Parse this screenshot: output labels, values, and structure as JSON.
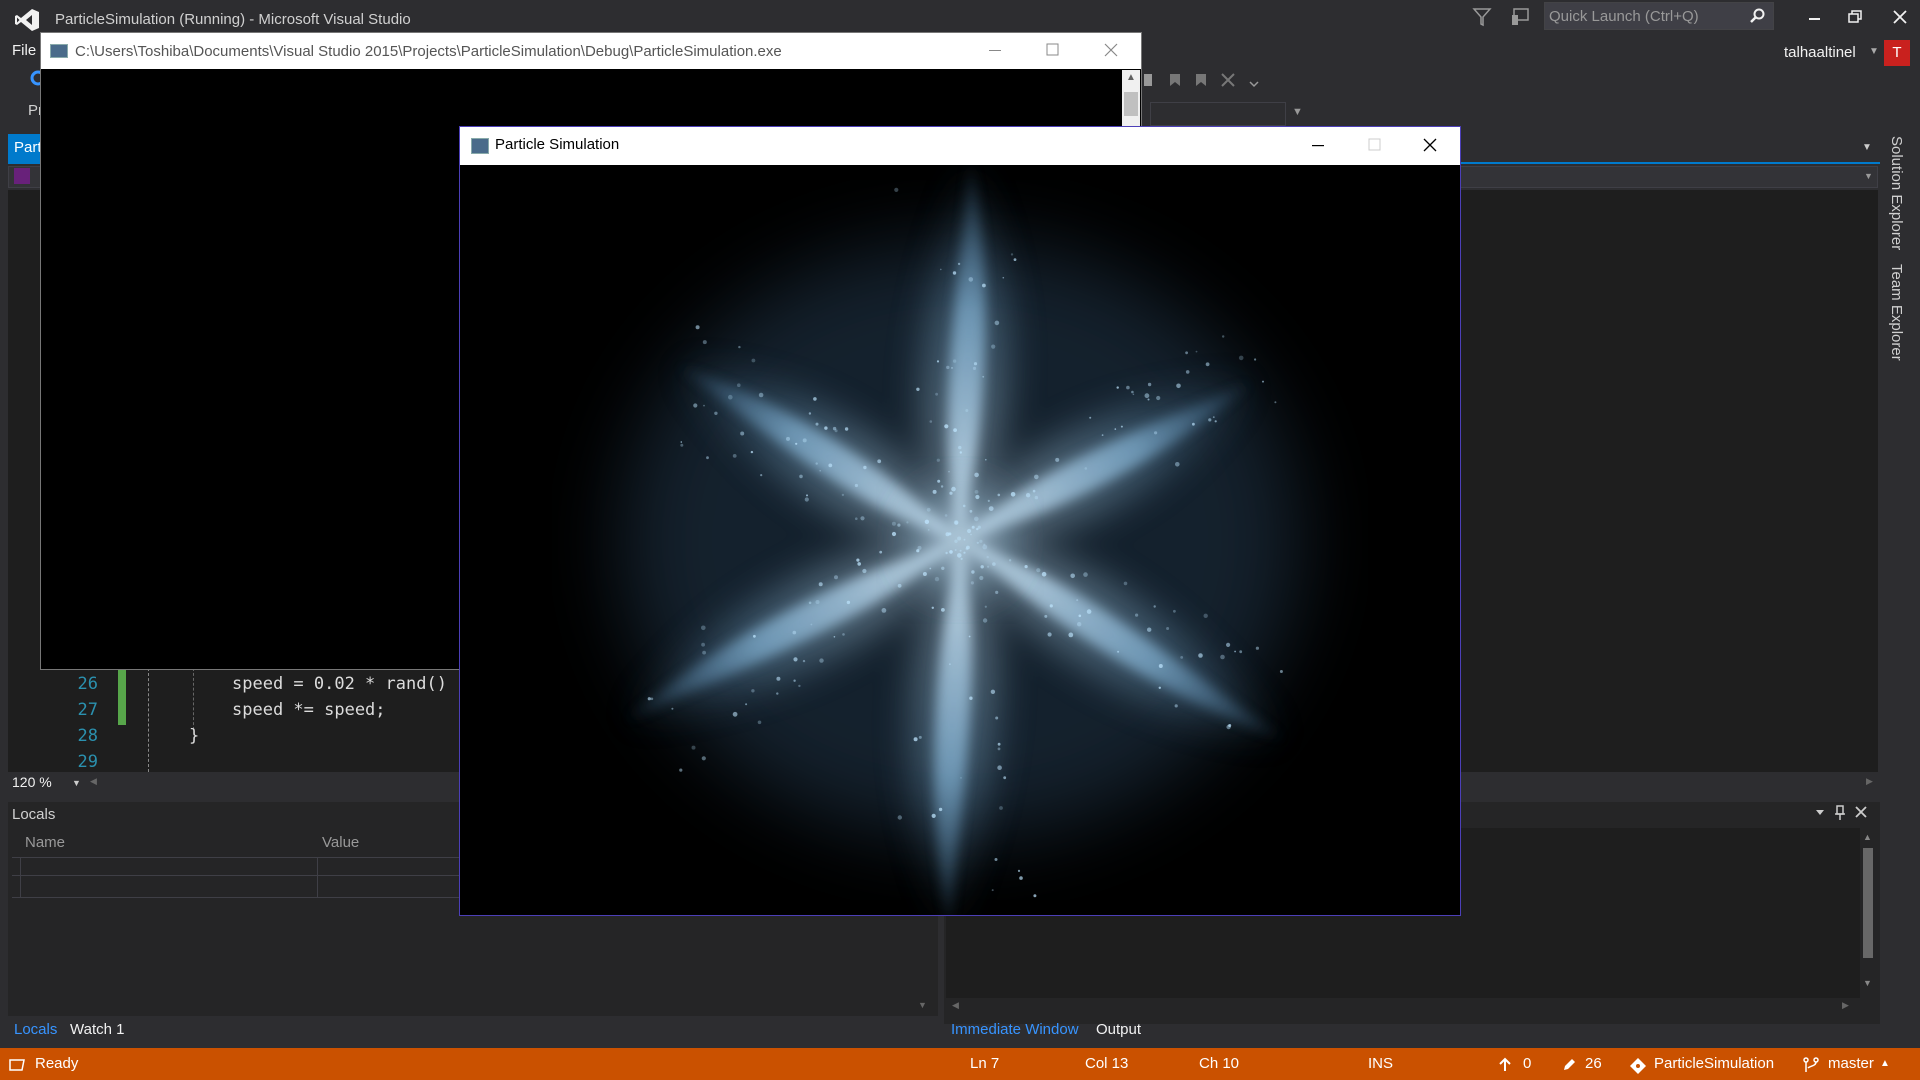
{
  "vs": {
    "title": "ParticleSimulation (Running) - Microsoft Visual Studio",
    "quick_launch_placeholder": "Quick Launch (Ctrl+Q)",
    "menu_file": "File",
    "user_name": "talhaaltinel",
    "user_initial": "T",
    "toolbar_partial_text": "Pr",
    "doc_tab_label": "Parti",
    "side_tabs": [
      "Solution Explorer",
      "Team Explorer"
    ],
    "zoom": "120 %"
  },
  "editor": {
    "lines": [
      {
        "num": "26",
        "code": "speed = 0.02 * rand()"
      },
      {
        "num": "27",
        "code": "speed *= speed;"
      },
      {
        "num": "28",
        "code": "}"
      },
      {
        "num": "29",
        "code": ""
      }
    ]
  },
  "locals": {
    "title": "Locals",
    "col_name": "Name",
    "col_value": "Value"
  },
  "bottom_tabs_left": [
    "Locals",
    "Watch 1"
  ],
  "bottom_tabs_right": [
    "Immediate Window",
    "Output"
  ],
  "status": {
    "ready": "Ready",
    "ln": "Ln 7",
    "col": "Col 13",
    "ch": "Ch 10",
    "ins": "INS",
    "up_count": "0",
    "edit_count": "26",
    "project": "ParticleSimulation",
    "branch": "master"
  },
  "console": {
    "title": "C:\\Users\\Toshiba\\Documents\\Visual Studio 2015\\Projects\\ParticleSimulation\\Debug\\ParticleSimulation.exe"
  },
  "particle": {
    "title": "Particle Simulation",
    "arms": 6
  },
  "colors": {
    "accent": "#007acc",
    "status_bar": "#ca5100",
    "particle_glow": "#bfe6ff"
  }
}
